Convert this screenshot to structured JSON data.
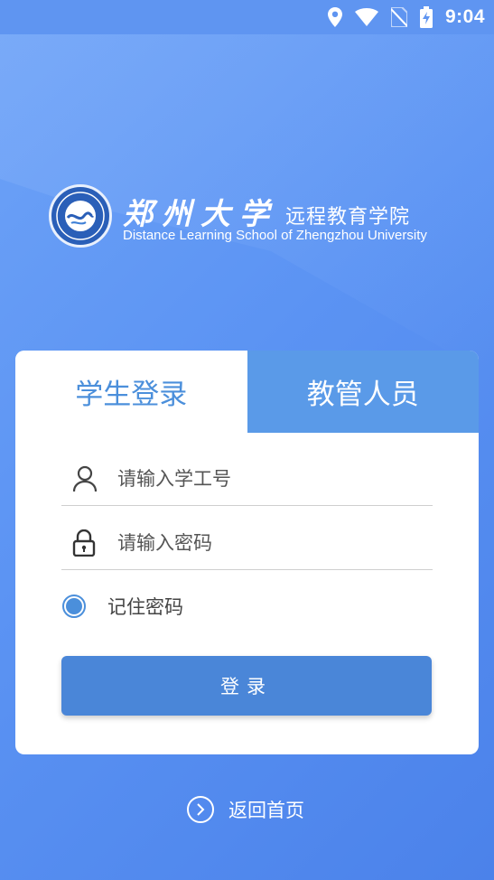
{
  "status_bar": {
    "time": "9:04",
    "icons": [
      "location-icon",
      "wifi-icon",
      "no-sim-icon",
      "battery-charging-icon"
    ]
  },
  "logo": {
    "name_cn": "郑州大学",
    "subtitle_cn": "远程教育学院",
    "name_en": "Distance Learning School of Zhengzhou University"
  },
  "tabs": [
    {
      "label": "学生登录",
      "active": true
    },
    {
      "label": "教管人员",
      "active": false
    }
  ],
  "form": {
    "username_placeholder": "请输入学工号",
    "password_placeholder": "请输入密码",
    "remember_label": "记住密码",
    "remember_checked": true,
    "login_label": "登录"
  },
  "footer": {
    "back_label": "返回首页"
  },
  "colors": {
    "accent": "#4b8fdb",
    "button": "#4a86d8",
    "inactive_tab": "#5a9ae8",
    "background": "#5b93f3"
  }
}
